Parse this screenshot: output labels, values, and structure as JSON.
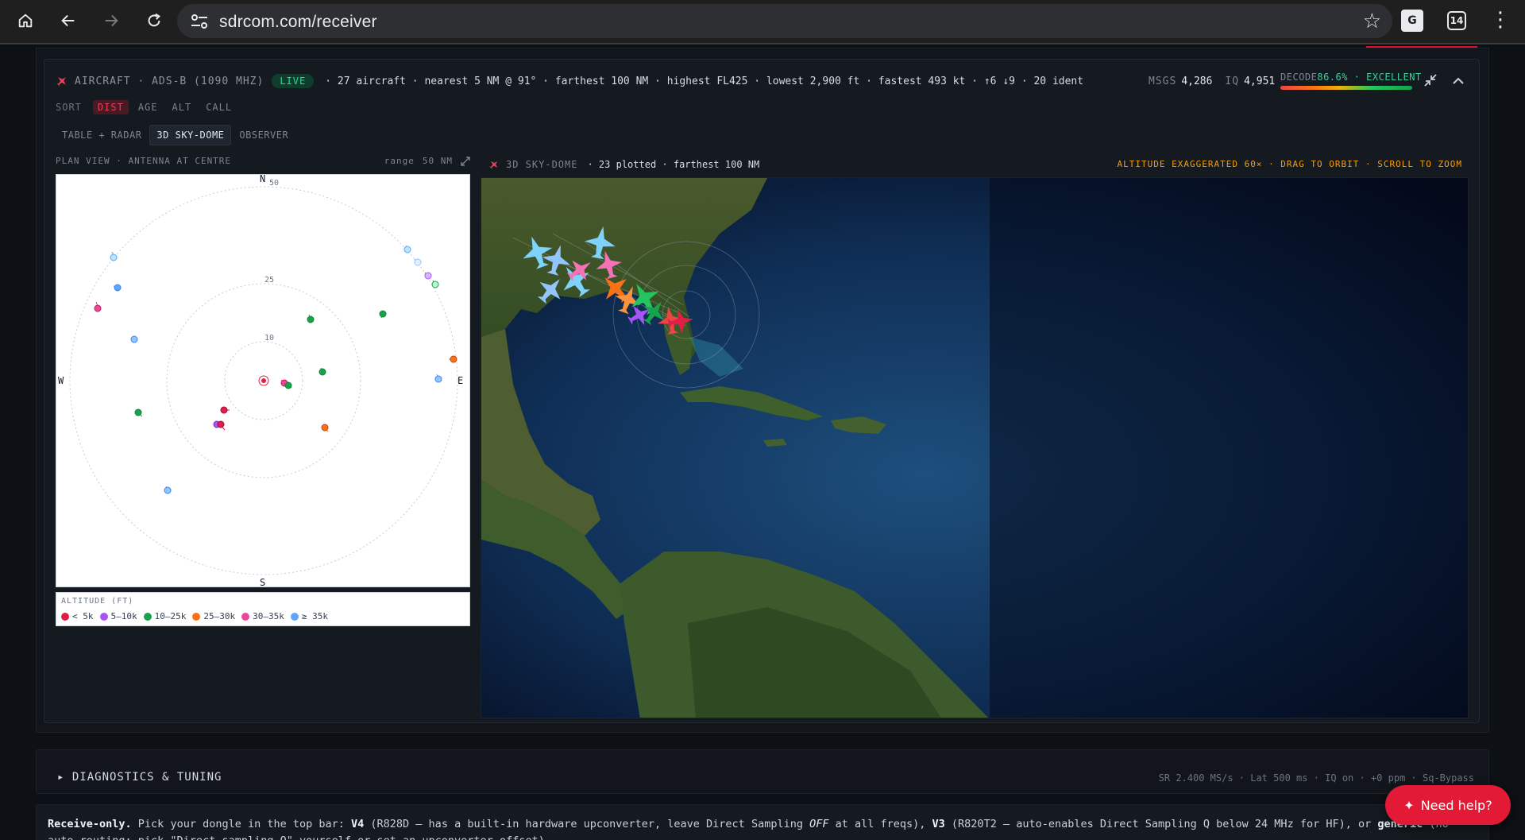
{
  "browser": {
    "url": "sdrcom.com/receiver",
    "tab_count": "14",
    "home_icon": "home-icon",
    "back_icon": "back-arrow-icon",
    "forward_icon": "forward-arrow-icon",
    "reload_icon": "reload-icon",
    "star_icon": "star-icon"
  },
  "aircraft": {
    "title": "AIRCRAFT · ADS-B (1090 MHZ)",
    "live_badge": "LIVE",
    "summary": "· 27 aircraft · nearest 5 NM @ 91° · farthest 100 NM · highest FL425 · lowest 2,900 ft · fastest 493 kt · ↑6 ↓9 · 20 ident",
    "msgs_label": "MSGS",
    "msgs_value": "4,286",
    "iq_label": "IQ",
    "iq_value": "4,951",
    "decode_label": "DECODE",
    "decode_value": "86.6% · EXCELLENT",
    "decode_fraction": 0.866
  },
  "sort": {
    "label": "SORT",
    "options": [
      "DIST",
      "AGE",
      "ALT",
      "CALL"
    ],
    "active": "DIST"
  },
  "view_tabs": [
    "TABLE + RADAR",
    "3D SKY-DOME",
    "OBSERVER"
  ],
  "active_view": "3D SKY-DOME",
  "plan_view": {
    "title": "PLAN VIEW · ANTENNA AT CENTRE",
    "range_label": "range",
    "range_value": "50 NM",
    "ring_labels": [
      "50",
      "25",
      "10"
    ],
    "compass": {
      "n": "N",
      "s": "S",
      "e": "E",
      "w": "W"
    }
  },
  "legend": {
    "title": "ALTITUDE (FT)",
    "items": [
      {
        "label": "< 5k",
        "color": "#e11d48"
      },
      {
        "label": "5–10k",
        "color": "#a855f7"
      },
      {
        "label": "10–25k",
        "color": "#16a34a"
      },
      {
        "label": "25–30k",
        "color": "#f97316"
      },
      {
        "label": "30–35k",
        "color": "#ec4899"
      },
      {
        "label": "≥ 35k",
        "color": "#60a5fa"
      }
    ]
  },
  "sky_dome": {
    "title": "3D SKY-DOME",
    "summary": "· 23 plotted · farthest 100 NM",
    "hint": "ALTITUDE EXAGGERATED 60× · DRAG TO ORBIT · SCROLL TO ZOOM"
  },
  "diagnostics": {
    "title": "▸ DIAGNOSTICS & TUNING",
    "stats": "SR 2.400 MS/s · Lat 500 ms · IQ on · +0 ppm · Sq-Bypass"
  },
  "info": {
    "lead": "Receive-only.",
    "t1": " Pick your dongle in the top bar: ",
    "v4": "V4",
    "t2": " (R828D — has a built-in hardware upconverter, leave Direct Sampling ",
    "off": "OFF",
    "t3": " at all freqs), ",
    "v3": "V3",
    "t4": " (R820T2 — auto-enables Direct Sampling Q below 24 MHz for HF), or ",
    "generic": "generic",
    "t5": " (no auto-routing; pick \"Direct sampling Q\" yourself or set an upconverter offset)."
  },
  "help": {
    "label": "Need help?",
    "icon": "sparkle-icon"
  },
  "colors": {
    "accent_red": "#e21a36",
    "live_green": "#34d399",
    "warning_amber": "#f59e0b"
  }
}
